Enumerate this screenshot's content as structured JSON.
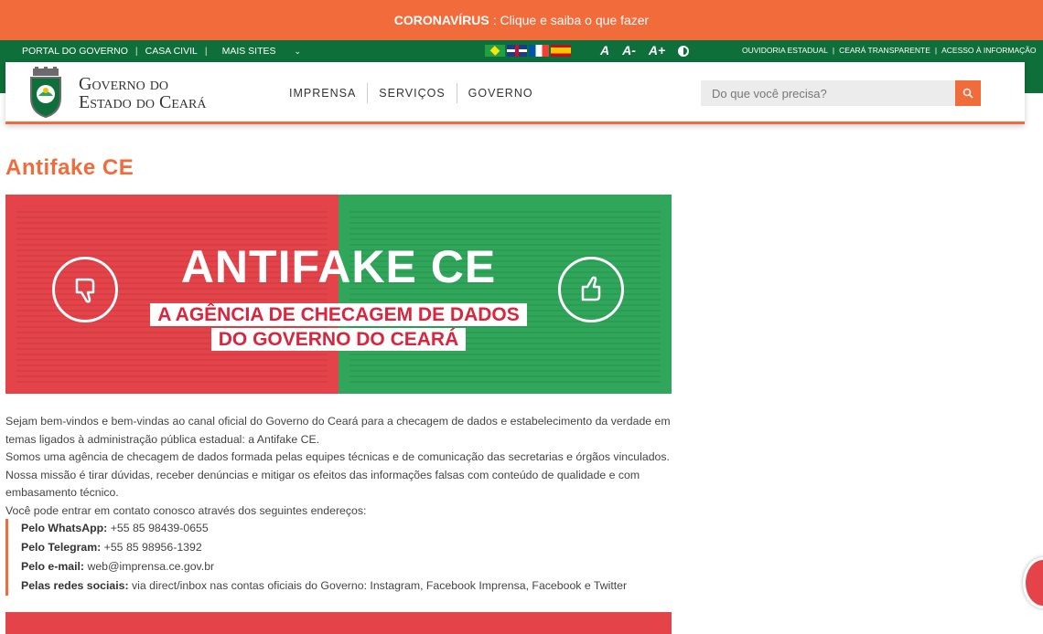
{
  "corona": {
    "bold": "CORONAVÍRUS",
    "text": ": Clique e saiba o que fazer"
  },
  "topbar": {
    "links": [
      "PORTAL DO GOVERNO",
      "CASA CIVIL",
      "MAIS SITES"
    ],
    "font_controls": [
      "A",
      "A-",
      "A+"
    ],
    "right_links": [
      "OUVIDORIA ESTADUAL",
      "CEARÁ TRANSPARENTE",
      "ACESSO À INFORMAÇÃO"
    ]
  },
  "header": {
    "brand_line1": "Governo do",
    "brand_line2": "Estado do Ceará",
    "nav": [
      "IMPRENSA",
      "SERVIÇOS",
      "GOVERNO"
    ],
    "search_placeholder": "Do que você precisa?"
  },
  "page": {
    "title": "Antifake CE",
    "banner_title": "ANTIFAKE CE",
    "banner_sub1": "A AGÊNCIA DE CHECAGEM DE DADOS",
    "banner_sub2": "DO GOVERNO DO CEARÁ",
    "intro": [
      "Sejam bem-vindos e bem-vindas ao canal oficial do Governo do Ceará para a checagem de dados e estabelecimento da verdade em temas ligados à administração pública estadual: a Antifake CE.",
      "Somos uma agência de checagem de dados formada pelas equipes técnicas e de comunicação das secretarias e órgãos vinculados. Nossa missão é tirar dúvidas, receber denúncias e mitigar os efeitos das informações falsas com conteúdo de qualidade e com embasamento técnico.",
      "Você pode entrar em contato conosco através dos seguintes endereços:"
    ],
    "contacts": [
      {
        "label": "Pelo WhatsApp:",
        "value": " +55 85 98439-0655"
      },
      {
        "label": "Pelo Telegram:",
        "value": " +55 85 98956-1392"
      },
      {
        "label": "Pelo e-mail:",
        "value": " web@imprensa.ce.gov.br"
      },
      {
        "label": "Pelas redes sociais:",
        "value": " via direct/inbox nas contas oficiais do Governo: Instagram, Facebook Imprensa, Facebook e Twitter"
      }
    ]
  },
  "colors": {
    "accent": "#f26b3a",
    "green": "#0e6f3a",
    "red": "#e4434a",
    "banner_green": "#2fa65a"
  }
}
